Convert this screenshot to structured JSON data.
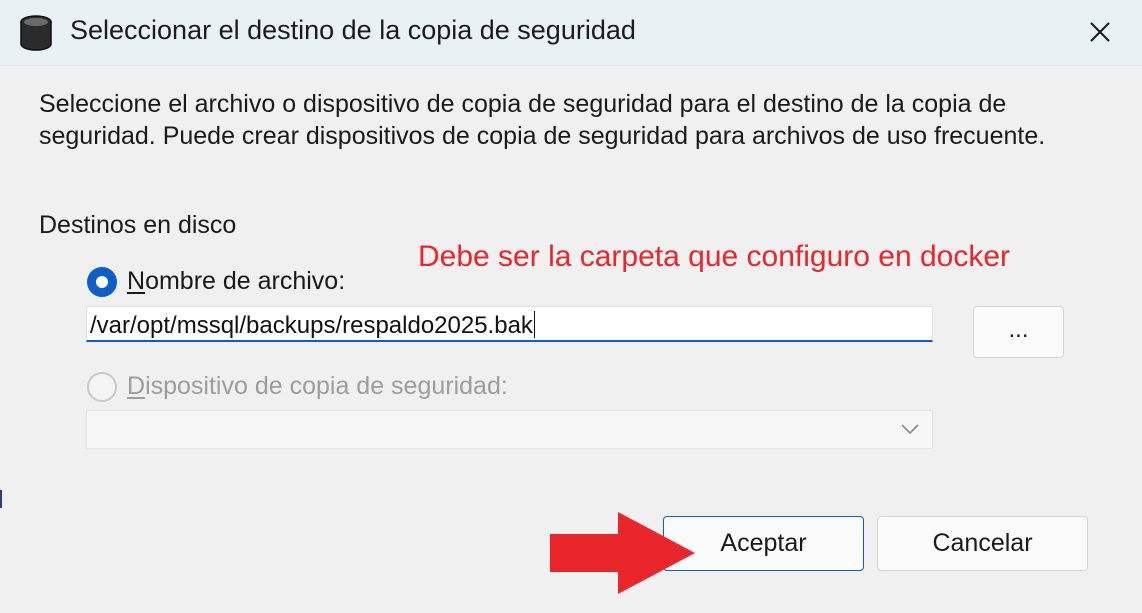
{
  "window": {
    "title": "Seleccionar el destino de la copia de seguridad",
    "icon": "database-icon",
    "close_icon": "close-icon"
  },
  "description": "Seleccione el archivo o dispositivo de copia de seguridad para el destino de la copia de seguridad. Puede crear dispositivos de copia de seguridad para archivos de uso frecuente.",
  "section": {
    "label": "Destinos en disco"
  },
  "annotation": {
    "text": "Debe ser la carpeta que configuro en docker",
    "color": "#e8262b"
  },
  "options": {
    "file_name": {
      "label_mnemonic": "N",
      "label_rest": "ombre de archivo:",
      "selected": true,
      "value": "/var/opt/mssql/backups/respaldo2025.bak",
      "browse_label": "..."
    },
    "device": {
      "label_mnemonic": "D",
      "label_rest": "ispositivo de copia de seguridad:",
      "selected": false,
      "enabled": false,
      "value": ""
    }
  },
  "buttons": {
    "ok": "Aceptar",
    "cancel": "Cancelar"
  },
  "colors": {
    "accent": "#0f5ec7",
    "arrow": "#e8262b"
  }
}
